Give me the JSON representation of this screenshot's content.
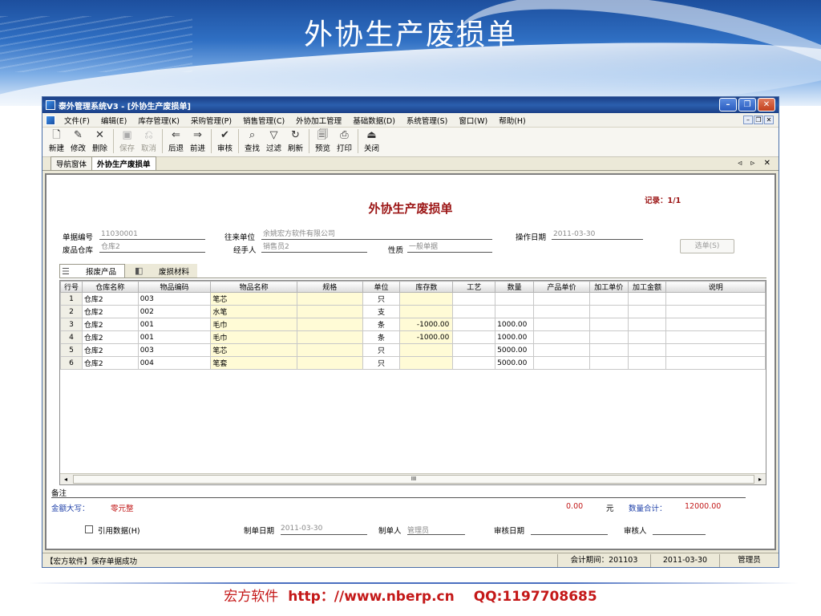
{
  "slide": {
    "title": "外协生产废损单",
    "footer_company": "宏方软件",
    "footer_url": "http：//www.nberp.cn",
    "footer_qq": "QQ:1197708685"
  },
  "window": {
    "title": "泰外管理系统V3 - [外协生产废损单]",
    "controls": [
      "minimize-icon",
      "restore-icon",
      "close-icon"
    ]
  },
  "menu": [
    "文件(F)",
    "编辑(E)",
    "库存管理(K)",
    "采购管理(P)",
    "销售管理(C)",
    "外协加工管理",
    "基础数据(D)",
    "系统管理(S)",
    "窗口(W)",
    "帮助(H)"
  ],
  "toolbar": [
    {
      "label": "新建",
      "icon": "new-file-icon",
      "glyph": "🗋",
      "enabled": true
    },
    {
      "label": "修改",
      "icon": "edit-icon",
      "glyph": "✎",
      "enabled": true
    },
    {
      "label": "删除",
      "icon": "delete-icon",
      "glyph": "✕",
      "enabled": true
    },
    {
      "sep": true
    },
    {
      "label": "保存",
      "icon": "save-icon",
      "glyph": "▣",
      "enabled": false
    },
    {
      "label": "取消",
      "icon": "cancel-icon",
      "glyph": "⎌",
      "enabled": false
    },
    {
      "sep": true
    },
    {
      "label": "后退",
      "icon": "back-arrow-icon",
      "glyph": "⇐",
      "enabled": true
    },
    {
      "label": "前进",
      "icon": "forward-arrow-icon",
      "glyph": "⇒",
      "enabled": true
    },
    {
      "sep": true
    },
    {
      "label": "审核",
      "icon": "approve-check-icon",
      "glyph": "✔",
      "enabled": true
    },
    {
      "sep": true
    },
    {
      "label": "查找",
      "icon": "find-binoculars-icon",
      "glyph": "⌕",
      "enabled": true
    },
    {
      "label": "过滤",
      "icon": "filter-funnel-icon",
      "glyph": "▽",
      "enabled": true
    },
    {
      "label": "刷新",
      "icon": "refresh-icon",
      "glyph": "↻",
      "enabled": true
    },
    {
      "sep": true
    },
    {
      "label": "预览",
      "icon": "preview-icon",
      "glyph": "🗐",
      "enabled": true
    },
    {
      "label": "打印",
      "icon": "print-icon",
      "glyph": "⎙",
      "enabled": true
    },
    {
      "sep": true
    },
    {
      "label": "关闭",
      "icon": "exit-icon",
      "glyph": "⏏",
      "enabled": true
    }
  ],
  "tabs": {
    "nav": "导航窗体",
    "active": "外协生产废损单",
    "nav_arrows": "◃ ▹ ✕"
  },
  "form": {
    "title": "外协生产废损单",
    "record": "记录：1/1",
    "doc_no_label": "单据编号",
    "doc_no": "11030001",
    "partner_label": "往来单位",
    "partner": "余姚宏方软件有限公司",
    "op_date_label": "操作日期",
    "op_date": "2011-03-30",
    "warehouse_label": "废品仓库",
    "warehouse": "仓库2",
    "handler_label": "经手人",
    "handler": "销售员2",
    "nature_label": "性质",
    "nature": "一般单据",
    "select_button": "选单(S)"
  },
  "subtabs": [
    {
      "label": "报废产品",
      "icon": "list-icon"
    },
    {
      "label": "废损材料",
      "icon": "material-icon"
    }
  ],
  "grid": {
    "columns": [
      "行号",
      "仓库名称",
      "物品编码",
      "物品名称",
      "规格",
      "单位",
      "库存数",
      "工艺",
      "数量",
      "产品单价",
      "加工单价",
      "加工金额",
      "说明"
    ],
    "rows": [
      [
        "1",
        "仓库2",
        "003",
        "笔芯",
        "",
        "只",
        "",
        "",
        "",
        "",
        "",
        "",
        ""
      ],
      [
        "2",
        "仓库2",
        "002",
        "水笔",
        "",
        "支",
        "",
        "",
        "",
        "",
        "",
        "",
        ""
      ],
      [
        "3",
        "仓库2",
        "001",
        "毛巾",
        "",
        "条",
        "-1000.00",
        "",
        "1000.00",
        "",
        "",
        "",
        ""
      ],
      [
        "4",
        "仓库2",
        "001",
        "毛巾",
        "",
        "条",
        "-1000.00",
        "",
        "1000.00",
        "",
        "",
        "",
        ""
      ],
      [
        "5",
        "仓库2",
        "003",
        "笔芯",
        "",
        "只",
        "",
        "",
        "5000.00",
        "",
        "",
        "",
        ""
      ],
      [
        "6",
        "仓库2",
        "004",
        "笔套",
        "",
        "只",
        "",
        "",
        "5000.00",
        "",
        "",
        "",
        ""
      ]
    ],
    "scroll_marker": "III"
  },
  "footer_form": {
    "remarks_label": "备注",
    "amount_words_label": "金额大写：",
    "amount_words": "零元整",
    "amount": "0.00",
    "currency": "元",
    "qty_total_label": "数量合计：",
    "qty_total": "12000.00",
    "quote_checkbox": "引用数据(H)",
    "maker_date_label": "制单日期",
    "maker_date": "2011-03-30",
    "maker_label": "制单人",
    "maker": "管理员",
    "audit_date_label": "审核日期",
    "audit_date": "",
    "auditor_label": "审核人",
    "auditor": ""
  },
  "status": {
    "message": "【宏方软件】保存单据成功",
    "period": "会计期间：201103",
    "date": "2011-03-30",
    "user": "管理员"
  },
  "colors": {
    "title_red": "#9b1414",
    "blue_label": "#1d3fa8",
    "yellow_cell": "#fffbd6"
  }
}
